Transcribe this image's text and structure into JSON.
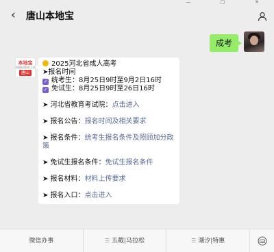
{
  "header": {
    "back_icon": "chevron-left-icon",
    "title": "唐山本地宝",
    "user_icon": "person-icon",
    "window_controls": [
      "minimize-icon",
      "maximize-icon",
      "close-icon"
    ]
  },
  "messages": {
    "outgoing": {
      "text": "成考"
    },
    "incoming": {
      "avatar_text_top": "本地宝",
      "avatar_text_mid": "BENDIBAO.COM",
      "avatar_text_bottom": "唐山",
      "title": "2025河北省成人高考",
      "registration_time_heading": "➤报名时间",
      "exam_candidates_label": "统考生：",
      "exam_candidates_time": "8月25日9时至9月2日16时",
      "exempt_candidates_label": "免试生：",
      "exempt_candidates_time": "8月25日9时至26日16时",
      "hebei_exam_institute_label": "➤ 河北省教育考试院：",
      "hebei_exam_institute_link": "点击进入",
      "announcement_label": "➤ 报名公告：",
      "announcement_link": "报名时间及相关要求",
      "conditions_label": "➤ 报名条件：",
      "conditions_link": "统考生报名条件及照顾加分政策",
      "exempt_conditions_label": "➤ 免试生报名条件：",
      "exempt_conditions_link": "免试生报名条件",
      "materials_label": "➤ 报名材料：",
      "materials_link": "材料上传要求",
      "entrance_label": "➤ 报名入口：",
      "entrance_link": "点击进入"
    }
  },
  "bottom_menu": {
    "items": [
      {
        "label": "微信办事"
      },
      {
        "label": "五截|马拉松"
      },
      {
        "label": "潮汐|特惠"
      }
    ],
    "keyboard_icon": "keyboard-icon"
  },
  "colors": {
    "background": "#ededed",
    "outgoing_bubble": "#95ec69",
    "link": "#576b95",
    "checkbox": "#7a5fd1",
    "dot": "#f5b800"
  }
}
